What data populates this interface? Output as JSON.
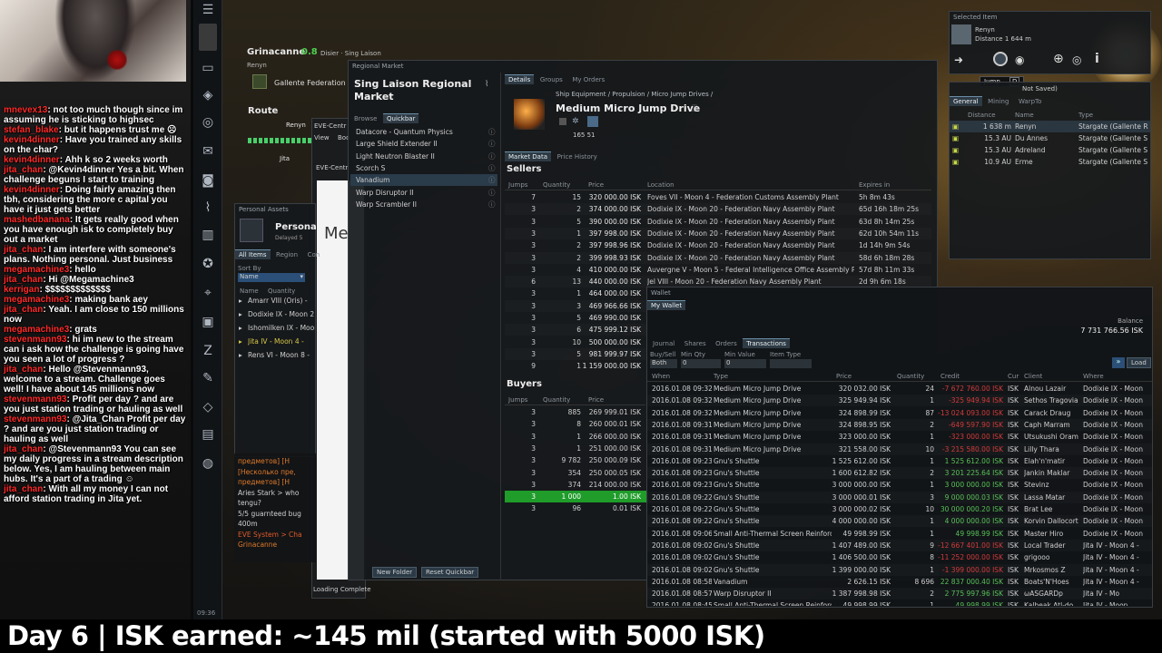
{
  "caption": "Day 6 | ISK earned: ~145 mil  (started with 5000 ISK)",
  "chat": [
    {
      "user": "mnevex13",
      "text": ": not too much though since im assuming he is sticking to highsec"
    },
    {
      "user": "stefan_blake",
      "text": ": but it happens trust me ☹"
    },
    {
      "user": "kevin4dinner",
      "text": ": Have you trained any skills on the char?"
    },
    {
      "user": "kevin4dinner",
      "text": ": Ahh k so 2 weeks worth"
    },
    {
      "user": "jita_chan",
      "text": ": @Kevin4dinner Yes a bit. When challenge beguns I start to training"
    },
    {
      "user": "kevin4dinner",
      "text": ": Doing fairly amazing then tbh, considering the more c apital you have it just gets better"
    },
    {
      "user": "mashedbanana",
      "text": ": It gets really good when you have enough isk to completely buy out a market"
    },
    {
      "user": "jita_chan",
      "text": ": I am interfere with someone's plans. Nothing personal. Just business"
    },
    {
      "user": "megamachine3",
      "text": ": hello"
    },
    {
      "user": "jita_chan",
      "text": ": Hi @Megamachine3"
    },
    {
      "user": "kerrigan",
      "text": ": $$$$$$$$$$$$$"
    },
    {
      "user": "megamachine3",
      "text": ": making bank aey"
    },
    {
      "user": "jita_chan",
      "text": ": Yeah. I am close to 150 millions now"
    },
    {
      "user": "megamachine3",
      "text": ": grats"
    },
    {
      "user": "stevenmann93",
      "text": ": hi im new to the stream can i ask how the challenge is going have you seen a lot of progress ?"
    },
    {
      "user": "jita_chan",
      "text": ": Hello @Stevenmann93, welcome to a stream. Challenge goes well! I have about 145 millions now"
    },
    {
      "user": "stevenmann93",
      "text": ": Profit per day ? and are you just station trading or hauling as well"
    },
    {
      "user": "stevenmann93",
      "text": ": @Jita_Chan Profit per day ? and are you just station trading or hauling as well"
    },
    {
      "user": "jita_chan",
      "text": ": @Stevenmann93 You can see my daily progress in a stream description below. Yes, I am hauling between main hubs. It's a part of a trading ☺"
    },
    {
      "user": "jita_chan",
      "text": ": With all my money I can not afford station trading in Jita yet."
    }
  ],
  "hud": {
    "char_name": "Grinacanne",
    "sec_status": "0.8",
    "location": "Disier · Sing Laison",
    "ship": "Renyn",
    "faction": "Gallente Federation",
    "route_label": "Route",
    "route_dest": "Renyn",
    "route_jita": "Jita"
  },
  "selected_item": {
    "title": "Selected Item",
    "name": "Renyn",
    "distance": "Distance 1 644 m",
    "tooltip": "Jump",
    "tooltip_key": "D"
  },
  "overview": {
    "status": "Not Saved)",
    "tabs": [
      "General",
      "Mining",
      "WarpTo"
    ],
    "columns": [
      "Distance",
      "Name",
      "Type"
    ],
    "rows": [
      {
        "distance": "1 638 m",
        "name": "Renyn",
        "type": "Stargate (Gallente R"
      },
      {
        "distance": "15.3 AU",
        "name": "Du Annes",
        "type": "Stargate (Gallente S"
      },
      {
        "distance": "15.3 AU",
        "name": "Adreland",
        "type": "Stargate (Gallente S"
      },
      {
        "distance": "10.9 AU",
        "name": "Erme",
        "type": "Stargate (Gallente S"
      }
    ]
  },
  "market": {
    "window_title": "Regional Market",
    "region_title": "Sing Laison Regional Market",
    "tabs_left": [
      "Browse",
      "Quickbar"
    ],
    "quickbar": [
      "Datacore - Quantum Physics",
      "Large Shield Extender II",
      "Light Neutron Blaster II",
      "Scorch S",
      "Vanadium",
      "Warp Disruptor II",
      "Warp Scrambler II"
    ],
    "btn_new_folder": "New Folder",
    "btn_reset": "Reset Quickbar",
    "tabs_right": [
      "Details",
      "Groups",
      "My Orders"
    ],
    "breadcrumb": "Ship Equipment / Propulsion / Micro Jump Drives /",
    "item_name": "Medium Micro Jump Drive",
    "item_stats": "165  51",
    "subtabs": [
      "Market Data",
      "Price History"
    ],
    "sellers_label": "Sellers",
    "buyers_label": "Buyers",
    "sell_cols": [
      "Jumps",
      "Quantity",
      "Price",
      "Location",
      "Expires in"
    ],
    "sellers": [
      {
        "jumps": "7",
        "qty": "15",
        "price": "320 000.00 ISK",
        "loc": "Foves VII - Moon 4 - Federation Customs Assembly Plant",
        "exp": "5h 8m 43s"
      },
      {
        "jumps": "3",
        "qty": "2",
        "price": "374 000.00 ISK",
        "loc": "Dodixie IX - Moon 20 - Federation Navy Assembly Plant",
        "exp": "65d 16h 18m 25s"
      },
      {
        "jumps": "3",
        "qty": "5",
        "price": "390 000.00 ISK",
        "loc": "Dodixie IX - Moon 20 - Federation Navy Assembly Plant",
        "exp": "63d 8h 14m 25s"
      },
      {
        "jumps": "3",
        "qty": "1",
        "price": "397 998.00 ISK",
        "loc": "Dodixie IX - Moon 20 - Federation Navy Assembly Plant",
        "exp": "62d 10h 54m 11s"
      },
      {
        "jumps": "3",
        "qty": "2",
        "price": "397 998.96 ISK",
        "loc": "Dodixie IX - Moon 20 - Federation Navy Assembly Plant",
        "exp": "1d 14h 9m 54s"
      },
      {
        "jumps": "3",
        "qty": "2",
        "price": "399 998.93 ISK",
        "loc": "Dodixie IX - Moon 20 - Federation Navy Assembly Plant",
        "exp": "58d 6h 18m 28s"
      },
      {
        "jumps": "3",
        "qty": "4",
        "price": "410 000.00 ISK",
        "loc": "Auvergne V - Moon 5 - Federal Intelligence Office Assembly Pl",
        "exp": "57d 8h 11m 33s"
      },
      {
        "jumps": "6",
        "qty": "13",
        "price": "440 000.00 ISK",
        "loc": "Jel VIII - Moon 20 - Federation Navy Assembly Plant",
        "exp": "2d 9h 6m 18s"
      },
      {
        "jumps": "3",
        "qty": "1",
        "price": "464 000.00 ISK",
        "loc": "",
        "exp": ""
      },
      {
        "jumps": "3",
        "qty": "3",
        "price": "469 966.66 ISK",
        "loc": "",
        "exp": ""
      },
      {
        "jumps": "3",
        "qty": "5",
        "price": "469 990.00 ISK",
        "loc": "",
        "exp": ""
      },
      {
        "jumps": "3",
        "qty": "6",
        "price": "475 999.12 ISK",
        "loc": "",
        "exp": ""
      },
      {
        "jumps": "3",
        "qty": "10",
        "price": "500 000.00 ISK",
        "loc": "",
        "exp": ""
      },
      {
        "jumps": "3",
        "qty": "5",
        "price": "981 999.97 ISK",
        "loc": "",
        "exp": ""
      },
      {
        "jumps": "9",
        "qty": "1",
        "price": "1 159 000.00 ISK",
        "loc": "",
        "exp": ""
      }
    ],
    "buy_cols": [
      "Jumps",
      "Quantity",
      "Price"
    ],
    "buyers": [
      {
        "jumps": "3",
        "qty": "885",
        "price": "269 999.01 ISK"
      },
      {
        "jumps": "3",
        "qty": "8",
        "price": "260 000.01 ISK"
      },
      {
        "jumps": "3",
        "qty": "1",
        "price": "266 000.00 ISK"
      },
      {
        "jumps": "3",
        "qty": "1",
        "price": "251 000.00 ISK"
      },
      {
        "jumps": "3",
        "qty": "9 782",
        "price": "250 000.09 ISK"
      },
      {
        "jumps": "3",
        "qty": "354",
        "price": "250 000.05 ISK"
      },
      {
        "jumps": "3",
        "qty": "374",
        "price": "214 000.00 ISK"
      },
      {
        "jumps": "3",
        "qty": "1 000",
        "price": "1.00 ISK",
        "highlight": true
      },
      {
        "jumps": "3",
        "qty": "96",
        "price": "0.01 ISK"
      }
    ]
  },
  "assets": {
    "title": "Personal Assets",
    "heading": "Persona",
    "sub": "Delayed 5",
    "tabs": [
      "All Items",
      "Region",
      "Con"
    ],
    "sort_label": "Sort By",
    "sort_value": "Name",
    "cols": [
      "Name",
      "Quantity"
    ],
    "rows": [
      "Amarr VIII (Oris) -",
      "Dodixie IX - Moon 2",
      "Ishomilken IX - Moon",
      "Jita IV - Moon 4 -",
      "Rens VI - Moon 8 -"
    ]
  },
  "local_chat": {
    "lines": [
      "предметов] [H",
      "[Несколько пре,",
      "предметов] [H",
      "Aries Stark > who",
      "tengu?",
      "5/5 guarnteed bug",
      "400m",
      "EVE System > Cha",
      "Grinacanne"
    ],
    "status": "Loading Complete"
  },
  "wallet": {
    "title": "Wallet",
    "tab": "My Wallet",
    "balance_label": "Balance",
    "balance": "7 731 766.56 ISK",
    "subtabs": [
      "Journal",
      "Shares",
      "Orders",
      "Transactions"
    ],
    "filters": {
      "buysell_label": "Buy/Sell",
      "buysell": "Both",
      "minqty_label": "Min Qty",
      "minqty": "0",
      "minval_label": "Min Value",
      "minval": "0",
      "itemtype_label": "Item Type",
      "load": "Load"
    },
    "cols": [
      "When",
      "Type",
      "Price",
      "Quantity",
      "Credit",
      "Cur",
      "Client",
      "Where"
    ],
    "rows": [
      {
        "when": "2016.01.08 09:32",
        "type": "Medium Micro Jump Drive",
        "price": "320 032.00 ISK",
        "qty": "24",
        "credit": "-7 672 760.00 ISK",
        "neg": true,
        "cur": "ISK",
        "client": "Alnou Lazair",
        "where": "Dodixie IX - Moon"
      },
      {
        "when": "2016.01.08 09:32",
        "type": "Medium Micro Jump Drive",
        "price": "325 949.94 ISK",
        "qty": "1",
        "credit": "-325 949.94 ISK",
        "neg": true,
        "cur": "ISK",
        "client": "Sethos Tragovia",
        "where": "Dodixie IX - Moon"
      },
      {
        "when": "2016.01.08 09:32",
        "type": "Medium Micro Jump Drive",
        "price": "324 898.99 ISK",
        "qty": "87",
        "credit": "-13 024 093.00 ISK",
        "neg": true,
        "cur": "ISK",
        "client": "Carack Draug",
        "where": "Dodixie IX - Moon"
      },
      {
        "when": "2016.01.08 09:31",
        "type": "Medium Micro Jump Drive",
        "price": "324 898.95 ISK",
        "qty": "2",
        "credit": "-649 597.90 ISK",
        "neg": true,
        "cur": "ISK",
        "client": "Caph Marram",
        "where": "Dodixie IX - Moon"
      },
      {
        "when": "2016.01.08 09:31",
        "type": "Medium Micro Jump Drive",
        "price": "323 000.00 ISK",
        "qty": "1",
        "credit": "-323 000.00 ISK",
        "neg": true,
        "cur": "ISK",
        "client": "Utsukushi Oram",
        "where": "Dodixie IX - Moon"
      },
      {
        "when": "2016.01.08 09:31",
        "type": "Medium Micro Jump Drive",
        "price": "321 558.00 ISK",
        "qty": "10",
        "credit": "-3 215 580.00 ISK",
        "neg": true,
        "cur": "ISK",
        "client": "Lilly Thara",
        "where": "Dodixie IX - Moon"
      },
      {
        "when": "2016.01.08 09:23",
        "type": "Gnu's Shuttle",
        "price": "1 525 612.00 ISK",
        "qty": "1",
        "credit": "1 525 612.00 ISK",
        "neg": false,
        "cur": "ISK",
        "client": "Elah'n'matir",
        "where": "Dodixie IX - Moon"
      },
      {
        "when": "2016.01.08 09:23",
        "type": "Gnu's Shuttle",
        "price": "1 600 612.82 ISK",
        "qty": "2",
        "credit": "3 201 225.64 ISK",
        "neg": false,
        "cur": "ISK",
        "client": "Jankin Maklar",
        "where": "Dodixie IX - Moon"
      },
      {
        "when": "2016.01.08 09:23",
        "type": "Gnu's Shuttle",
        "price": "3 000 000.00 ISK",
        "qty": "1",
        "credit": "3 000 000.00 ISK",
        "neg": false,
        "cur": "ISK",
        "client": "Stevinz",
        "where": "Dodixie IX - Moon"
      },
      {
        "when": "2016.01.08 09:22",
        "type": "Gnu's Shuttle",
        "price": "3 000 000.01 ISK",
        "qty": "3",
        "credit": "9 000 000.03 ISK",
        "neg": false,
        "cur": "ISK",
        "client": "Lassa Matar",
        "where": "Dodixie IX - Moon"
      },
      {
        "when": "2016.01.08 09:22",
        "type": "Gnu's Shuttle",
        "price": "3 000 000.02 ISK",
        "qty": "10",
        "credit": "30 000 000.20 ISK",
        "neg": false,
        "cur": "ISK",
        "client": "Brat Lee",
        "where": "Dodixie IX - Moon"
      },
      {
        "when": "2016.01.08 09:22",
        "type": "Gnu's Shuttle",
        "price": "4 000 000.00 ISK",
        "qty": "1",
        "credit": "4 000 000.00 ISK",
        "neg": false,
        "cur": "ISK",
        "client": "Korvin Dallocort",
        "where": "Dodixie IX - Moon"
      },
      {
        "when": "2016.01.08 09:06",
        "type": "Small Anti-Thermal Screen Reinforc",
        "price": "49 998.99 ISK",
        "qty": "1",
        "credit": "49 998.99 ISK",
        "neg": false,
        "cur": "ISK",
        "client": "Master Hiro",
        "where": "Dodixie IX - Moon"
      },
      {
        "when": "2016.01.08 09:02",
        "type": "Gnu's Shuttle",
        "price": "1 407 489.00 ISK",
        "qty": "9",
        "credit": "-12 667 401.00 ISK",
        "neg": true,
        "cur": "ISK",
        "client": "Local Trader",
        "where": "Jita IV - Moon 4 -"
      },
      {
        "when": "2016.01.08 09:02",
        "type": "Gnu's Shuttle",
        "price": "1 406 500.00 ISK",
        "qty": "8",
        "credit": "-11 252 000.00 ISK",
        "neg": true,
        "cur": "ISK",
        "client": "grigooo",
        "where": "Jita IV - Moon 4 -"
      },
      {
        "when": "2016.01.08 09:02",
        "type": "Gnu's Shuttle",
        "price": "1 399 000.00 ISK",
        "qty": "1",
        "credit": "-1 399 000.00 ISK",
        "neg": true,
        "cur": "ISK",
        "client": "Mrkosmos Z",
        "where": "Jita IV - Moon 4 -"
      },
      {
        "when": "2016.01.08 08:58",
        "type": "Vanadium",
        "price": "2 626.15 ISK",
        "qty": "8 696",
        "credit": "22 837 000.40 ISK",
        "neg": false,
        "cur": "ISK",
        "client": "Boats'N'Hoes",
        "where": "Jita IV - Moon 4 -"
      },
      {
        "when": "2016.01.08 08:57",
        "type": "Warp Disruptor II",
        "price": "1 387 998.98 ISK",
        "qty": "2",
        "credit": "2 775 997.96 ISK",
        "neg": false,
        "cur": "ISK",
        "client": "ωASGARDp",
        "where": "Jita IV - Mo"
      },
      {
        "when": "2016.01.08 08:45",
        "type": "Small Anti-Thermal Screen Reinforc",
        "price": "49 998.99 ISK",
        "qty": "1",
        "credit": "49 998.99 ISK",
        "neg": false,
        "cur": "ISK",
        "client": "Kalbeak Atl-do",
        "where": "Jita IV - Moon"
      }
    ]
  },
  "browser": {
    "title": "EVE-Centr",
    "tab2": "EVE-Centr",
    "view": "View",
    "book": "Boo",
    "big": "Me"
  },
  "clock": "09:36",
  "colors": {
    "accent": "#6a8fa8",
    "negative": "#d23a3a",
    "positive": "#58c058",
    "highlight": "#1f9c2a",
    "chat_user": "#ff2a2a"
  }
}
